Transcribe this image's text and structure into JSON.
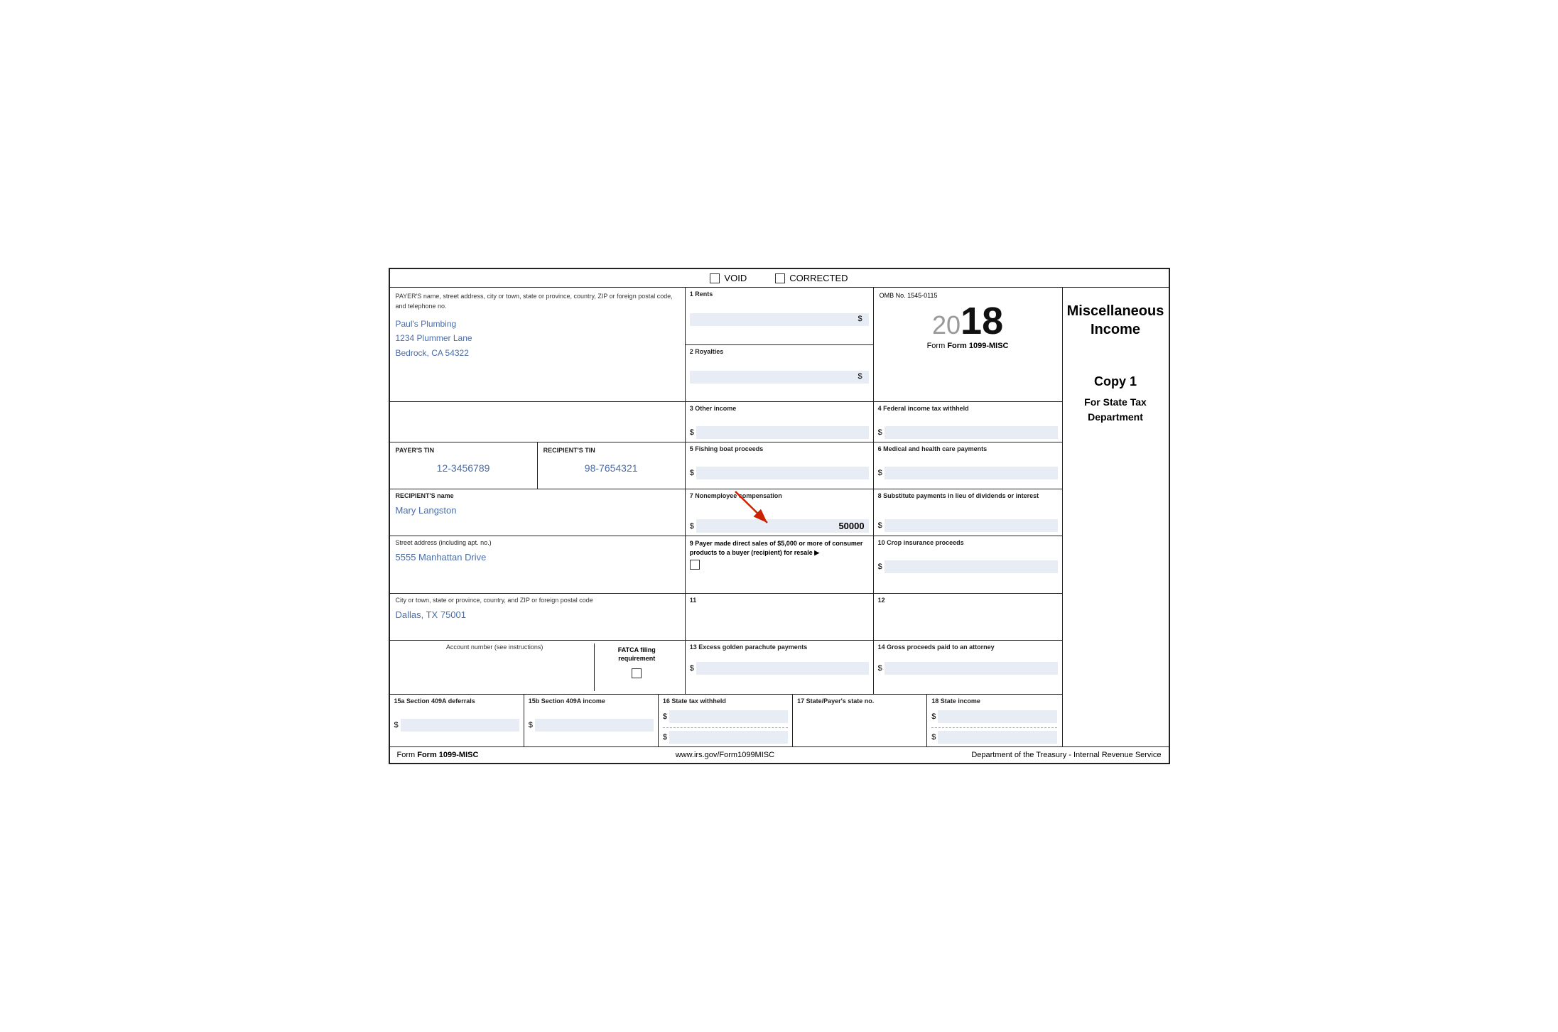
{
  "form": {
    "title": "Form 1099-MISC",
    "void_label": "VOID",
    "corrected_label": "CORRECTED",
    "omb": "OMB No. 1545-0115",
    "year_prefix": "20",
    "year_suffix": "18",
    "form_label": "Form 1099-MISC",
    "misc_income_title": "Miscellaneous\nIncome",
    "misc_income_line1": "Miscellaneous",
    "misc_income_line2": "Income",
    "website": "www.irs.gov/Form1099MISC",
    "footer_form": "Form 1099-MISC",
    "footer_dept": "Department of the Treasury - Internal Revenue Service"
  },
  "copy": {
    "copy1": "Copy 1",
    "for_state": "For State Tax",
    "department": "Department"
  },
  "payer": {
    "label": "PAYER'S name, street address, city or town, state or province, country, ZIP or foreign postal code, and telephone no.",
    "name": "Paul's Plumbing",
    "address": "1234 Plummer Lane",
    "city_state": "Bedrock, CA 54322"
  },
  "tin": {
    "payer_label": "PAYER'S TIN",
    "payer_value": "12-3456789",
    "recipient_label": "RECIPIENT'S TIN",
    "recipient_value": "98-7654321"
  },
  "recipient": {
    "name_label": "RECIPIENT'S name",
    "name_value": "Mary Langston",
    "street_label": "Street address (including apt. no.)",
    "street_value": "5555 Manhattan Drive",
    "city_label": "City or town, state or province, country, and ZIP or foreign postal code",
    "city_value": "Dallas, TX 75001"
  },
  "account": {
    "number_label": "Account number (see instructions)",
    "fatca_label": "FATCA filing requirement"
  },
  "boxes": {
    "b1_label": "1 Rents",
    "b1_value": "",
    "b2_label": "2 Royalties",
    "b2_value": "",
    "b3_label": "3 Other income",
    "b3_value": "",
    "b4_label": "4 Federal income tax withheld",
    "b4_value": "",
    "b5_label": "5 Fishing boat proceeds",
    "b5_value": "",
    "b6_label": "6 Medical and health care payments",
    "b6_value": "",
    "b7_label": "7 Nonemployee compensation",
    "b7_value": "50000",
    "b8_label": "8 Substitute payments in lieu of dividends or interest",
    "b8_value": "",
    "b9_label": "9 Payer made direct sales of $5,000 or more of consumer products to a buyer (recipient) for resale ▶",
    "b10_label": "10 Crop insurance proceeds",
    "b10_value": "",
    "b11_label": "11",
    "b11_value": "",
    "b12_label": "12",
    "b12_value": "",
    "b13_label": "13 Excess golden parachute payments",
    "b13_value": "",
    "b14_label": "14 Gross proceeds paid to an attorney",
    "b14_value": "",
    "b15a_label": "15a Section 409A deferrals",
    "b15a_value": "",
    "b15b_label": "15b Section 409A income",
    "b15b_value": "",
    "b16_label": "16 State tax withheld",
    "b16_value": "",
    "b17_label": "17 State/Payer's state no.",
    "b17_value": "",
    "b18_label": "18 State income",
    "b18_value": ""
  }
}
